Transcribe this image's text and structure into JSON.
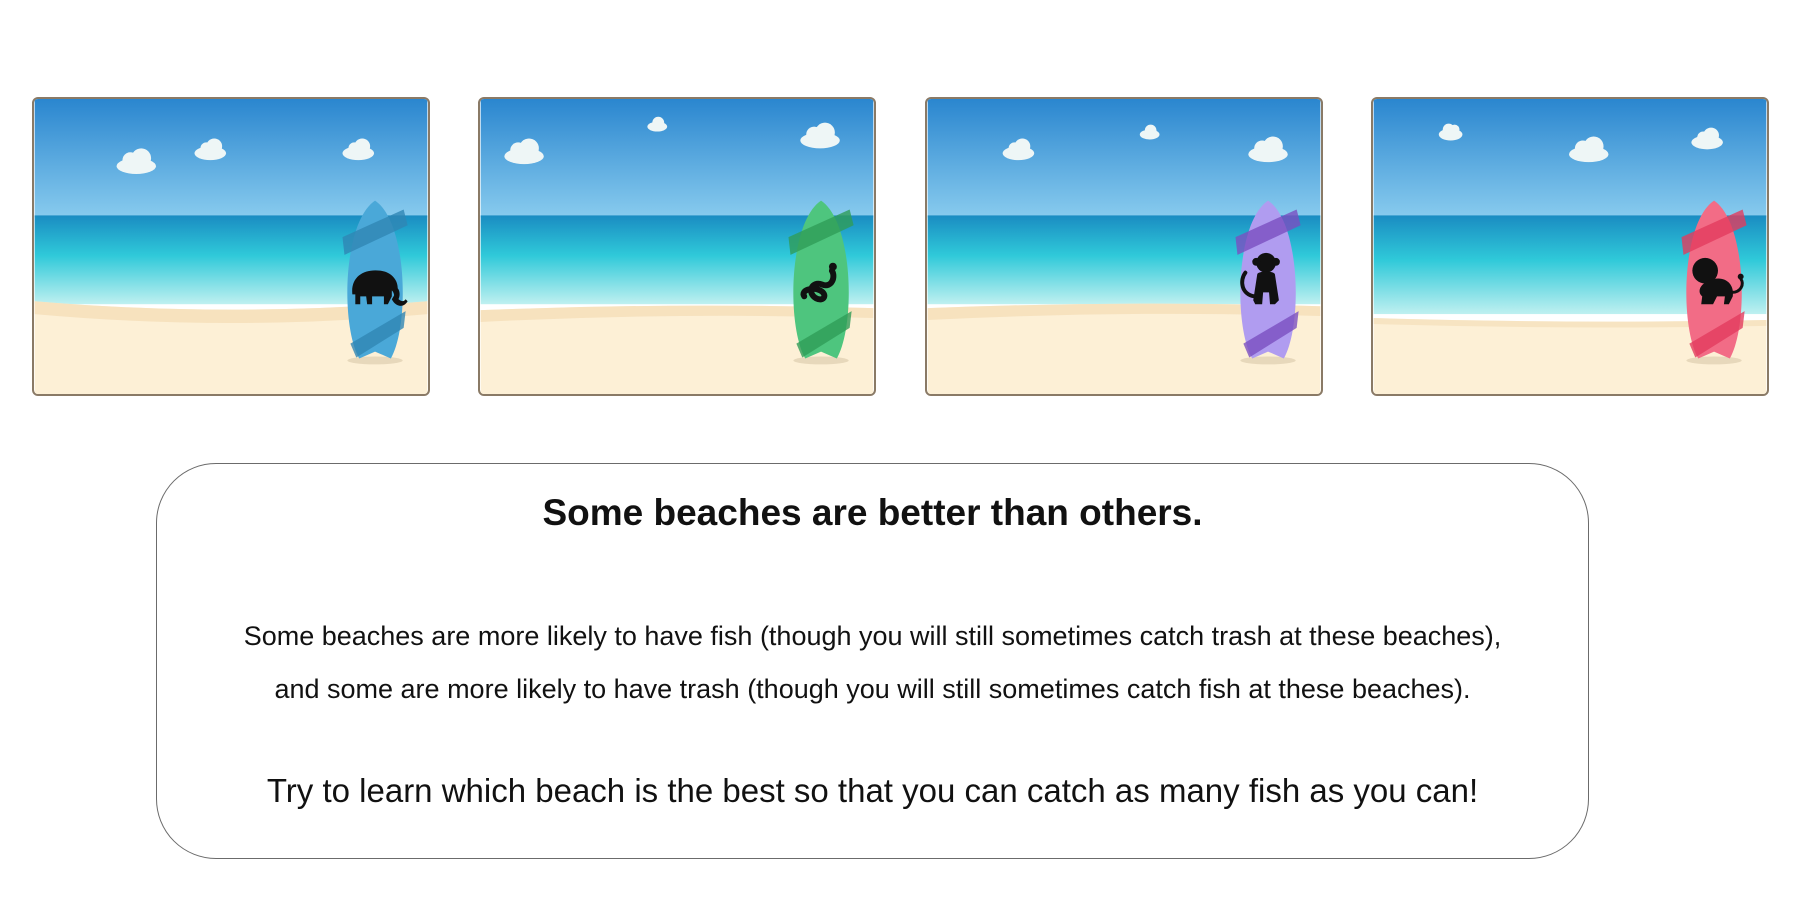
{
  "beaches": [
    {
      "id": "beach-1",
      "board_color": "#4aa8d8",
      "stripe_color": "#2f86b4",
      "animal": "elephant"
    },
    {
      "id": "beach-2",
      "board_color": "#4ec57e",
      "stripe_color": "#2f9c58",
      "animal": "snake"
    },
    {
      "id": "beach-3",
      "board_color": "#b09cf0",
      "stripe_color": "#7b4fc0",
      "animal": "monkey"
    },
    {
      "id": "beach-4",
      "board_color": "#f26c86",
      "stripe_color": "#e23c5e",
      "animal": "lion"
    }
  ],
  "colors": {
    "sky_top": "#2a86cf",
    "sky_bottom": "#88cbee",
    "sea_top": "#1a8cc2",
    "sea_mid": "#2fc9d9",
    "sea_light": "#bff0f0",
    "sand": "#fdf0d6",
    "sand_shadow": "#f4dcb4",
    "card_border": "#8a7a66"
  },
  "instructions": {
    "title": "Some beaches are better than others.",
    "line1": "Some beaches are more likely to have fish (though you will still sometimes catch trash at these beaches),",
    "line2": "and some are more likely to have trash (though you will still sometimes catch fish at these beaches).",
    "call_to_action": "Try to learn which beach is the best so that you can catch as many fish as you can!"
  }
}
